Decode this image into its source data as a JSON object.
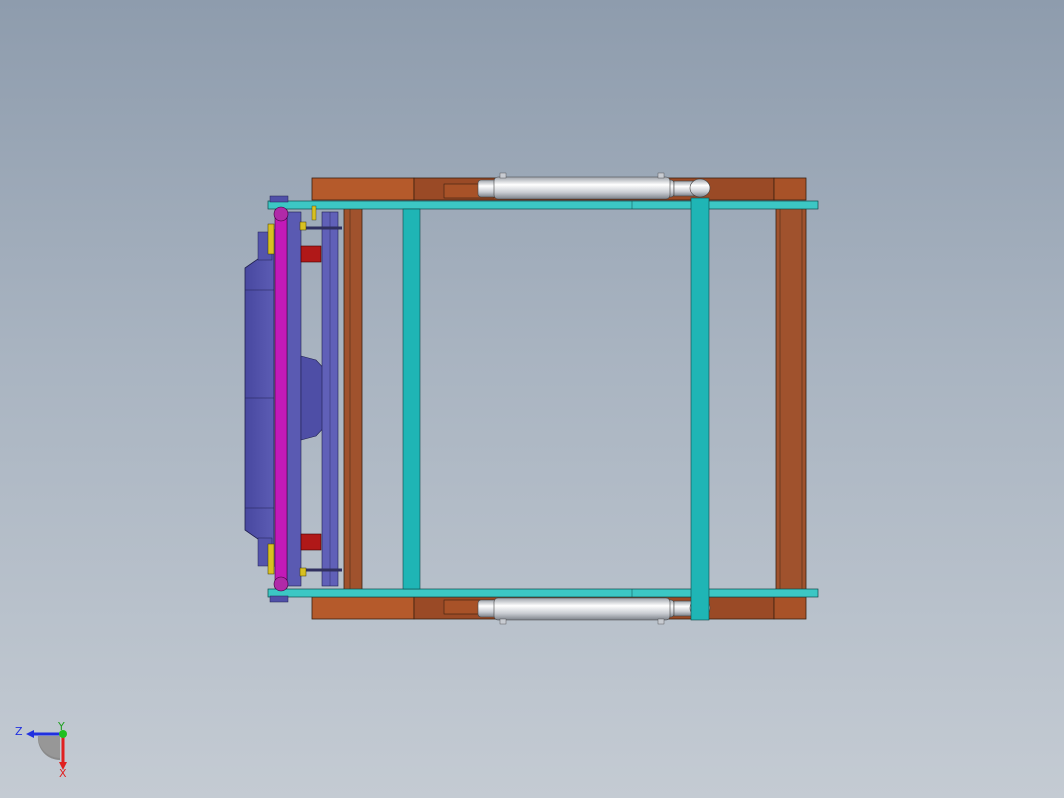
{
  "triad": {
    "z_label": "Z",
    "y_label": "Y",
    "x_label": "X"
  },
  "colors": {
    "frame_orange": "#b0582a",
    "frame_dark": "#8a4424",
    "cyan_rod": "#1fb5b5",
    "cyan_rail": "#3cc7c4",
    "blue_part": "#5050a8",
    "magenta_bar": "#c21ab8",
    "red_block": "#b01818",
    "cylinder_silver": "#d8dbe0",
    "axis_blue": "#2030e0",
    "axis_red": "#e02020",
    "axis_green": "#20c020"
  }
}
